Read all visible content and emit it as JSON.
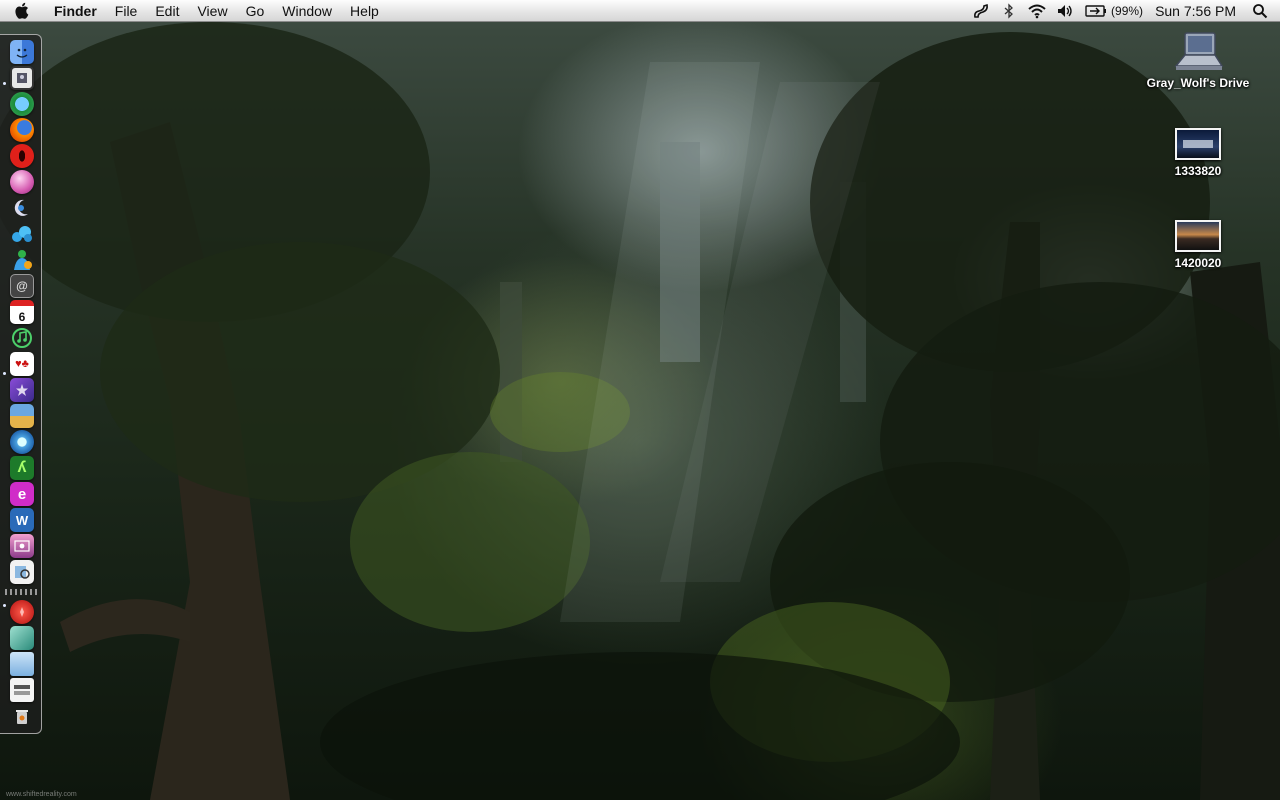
{
  "menubar": {
    "apple_icon": "apple-icon",
    "app_name": "Finder",
    "menus": [
      "File",
      "Edit",
      "View",
      "Go",
      "Window",
      "Help"
    ],
    "status_icons": [
      "script-icon",
      "bluetooth-icon",
      "wifi-icon",
      "volume-icon"
    ],
    "battery_percent": "(99%)",
    "clock": "Sun 7:56 PM",
    "spotlight_icon": "spotlight-icon"
  },
  "desktop": {
    "icons": [
      {
        "label": "Gray_Wolf's Drive",
        "icon": "hard-drive-icon"
      },
      {
        "label": "1333820",
        "icon": "image-file-icon"
      },
      {
        "label": "1420020",
        "icon": "image-file-icon"
      }
    ],
    "wallpaper_credit": "www.shiftedreality.com"
  },
  "dock": {
    "items": [
      {
        "name": "finder",
        "icon": "finder-icon",
        "running": true
      },
      {
        "name": "preview",
        "icon": "preview-icon",
        "running": false
      },
      {
        "name": "safari",
        "icon": "safari-icon",
        "running": false
      },
      {
        "name": "firefox",
        "icon": "firefox-icon",
        "running": false
      },
      {
        "name": "opera",
        "icon": "opera-icon",
        "running": false
      },
      {
        "name": "camino",
        "icon": "camino-icon",
        "running": false
      },
      {
        "name": "instantmessenger",
        "icon": "chat-icon",
        "running": false
      },
      {
        "name": "skype",
        "icon": "skype-icon",
        "running": false
      },
      {
        "name": "msn-messenger",
        "icon": "messenger-icon",
        "running": false
      },
      {
        "name": "mail",
        "icon": "mail-icon",
        "running": false
      },
      {
        "name": "ical",
        "icon": "calendar-icon",
        "running": false,
        "badge": "6"
      },
      {
        "name": "itunes",
        "icon": "itunes-icon",
        "running": true
      },
      {
        "name": "cards",
        "icon": "cards-icon",
        "running": false
      },
      {
        "name": "imovie",
        "icon": "imovie-icon",
        "running": false
      },
      {
        "name": "iphoto",
        "icon": "iphoto-icon",
        "running": false
      },
      {
        "name": "quicktime",
        "icon": "quicktime-icon",
        "running": false
      },
      {
        "name": "glims",
        "icon": "glims-icon",
        "running": false
      },
      {
        "name": "emule",
        "icon": "emule-icon",
        "running": false
      },
      {
        "name": "word",
        "icon": "word-icon",
        "running": false
      },
      {
        "name": "photo-app",
        "icon": "photo-app-icon",
        "running": false
      },
      {
        "name": "preview-2",
        "icon": "preview-app-icon",
        "running": true
      },
      {
        "name": "no-entry",
        "icon": "no-entry-icon",
        "running": false
      },
      {
        "name": "downloads",
        "icon": "downloads-icon",
        "running": false
      },
      {
        "name": "folder",
        "icon": "folder-icon",
        "running": false
      },
      {
        "name": "documents",
        "icon": "documents-icon",
        "running": false
      },
      {
        "name": "trash",
        "icon": "trash-icon",
        "running": false
      }
    ]
  },
  "colors": {
    "menubar_top": "#fdfdfd",
    "menubar_bottom": "#d6d6d6",
    "dock_bg": "#1e1e1e",
    "dock_border": "#dcdcdc"
  }
}
